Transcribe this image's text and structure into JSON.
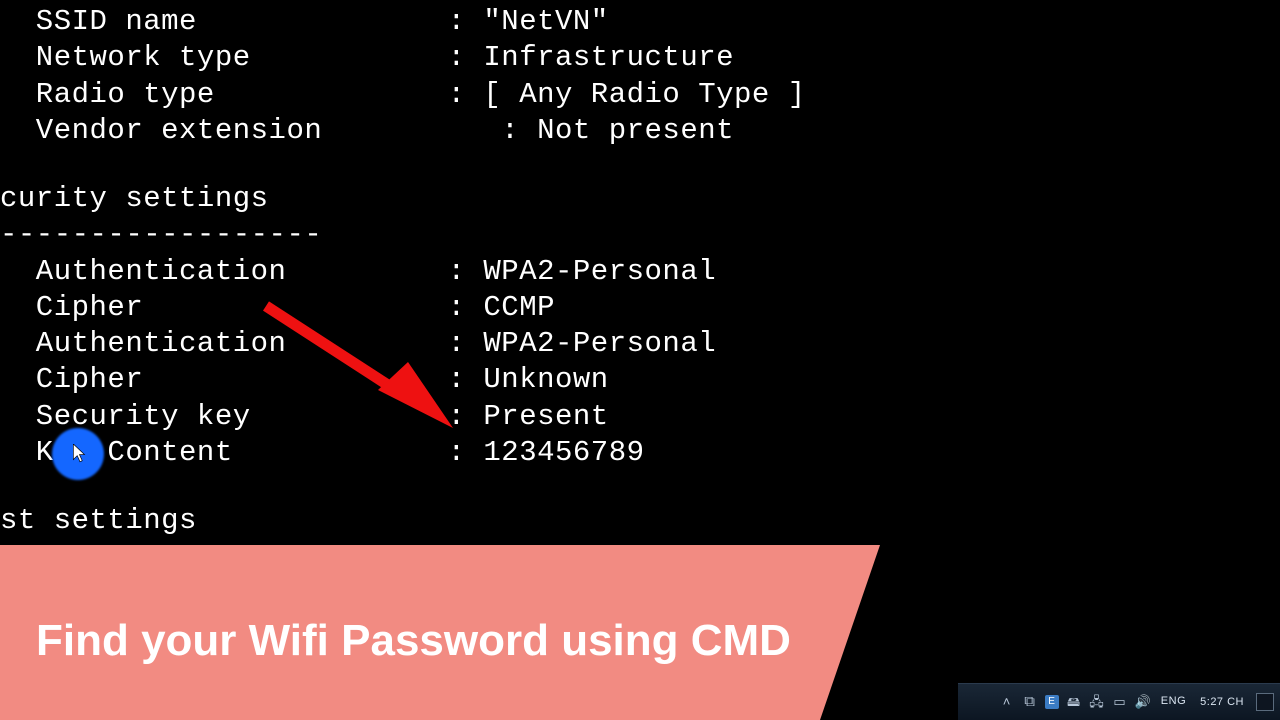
{
  "terminal": {
    "top": [
      {
        "label": "  SSID name",
        "value": "\"NetVN\""
      },
      {
        "label": "  Network type",
        "value": "Infrastructure"
      },
      {
        "label": "  Radio type",
        "value": "[ Any Radio Type ]"
      },
      {
        "label": "  Vendor extension",
        "value": "Not present",
        "indentValue": true
      }
    ],
    "sec_header": "curity settings",
    "sec_rule": "------------------",
    "sec": [
      {
        "label": "  Authentication",
        "value": "WPA2-Personal"
      },
      {
        "label": "  Cipher",
        "value": "CCMP"
      },
      {
        "label": "  Authentication",
        "value": "WPA2-Personal"
      },
      {
        "label": "  Cipher",
        "value": "Unknown"
      },
      {
        "label": "  Security key",
        "value": "Present"
      },
      {
        "label": "  Key Content",
        "value": "123456789"
      }
    ],
    "cost_header": "st settings"
  },
  "banner": {
    "text": "Find your Wifi Password using CMD",
    "color": "#f28b82"
  },
  "taskbar": {
    "time": "5:27 CH",
    "date": "",
    "lang": "ENG"
  }
}
